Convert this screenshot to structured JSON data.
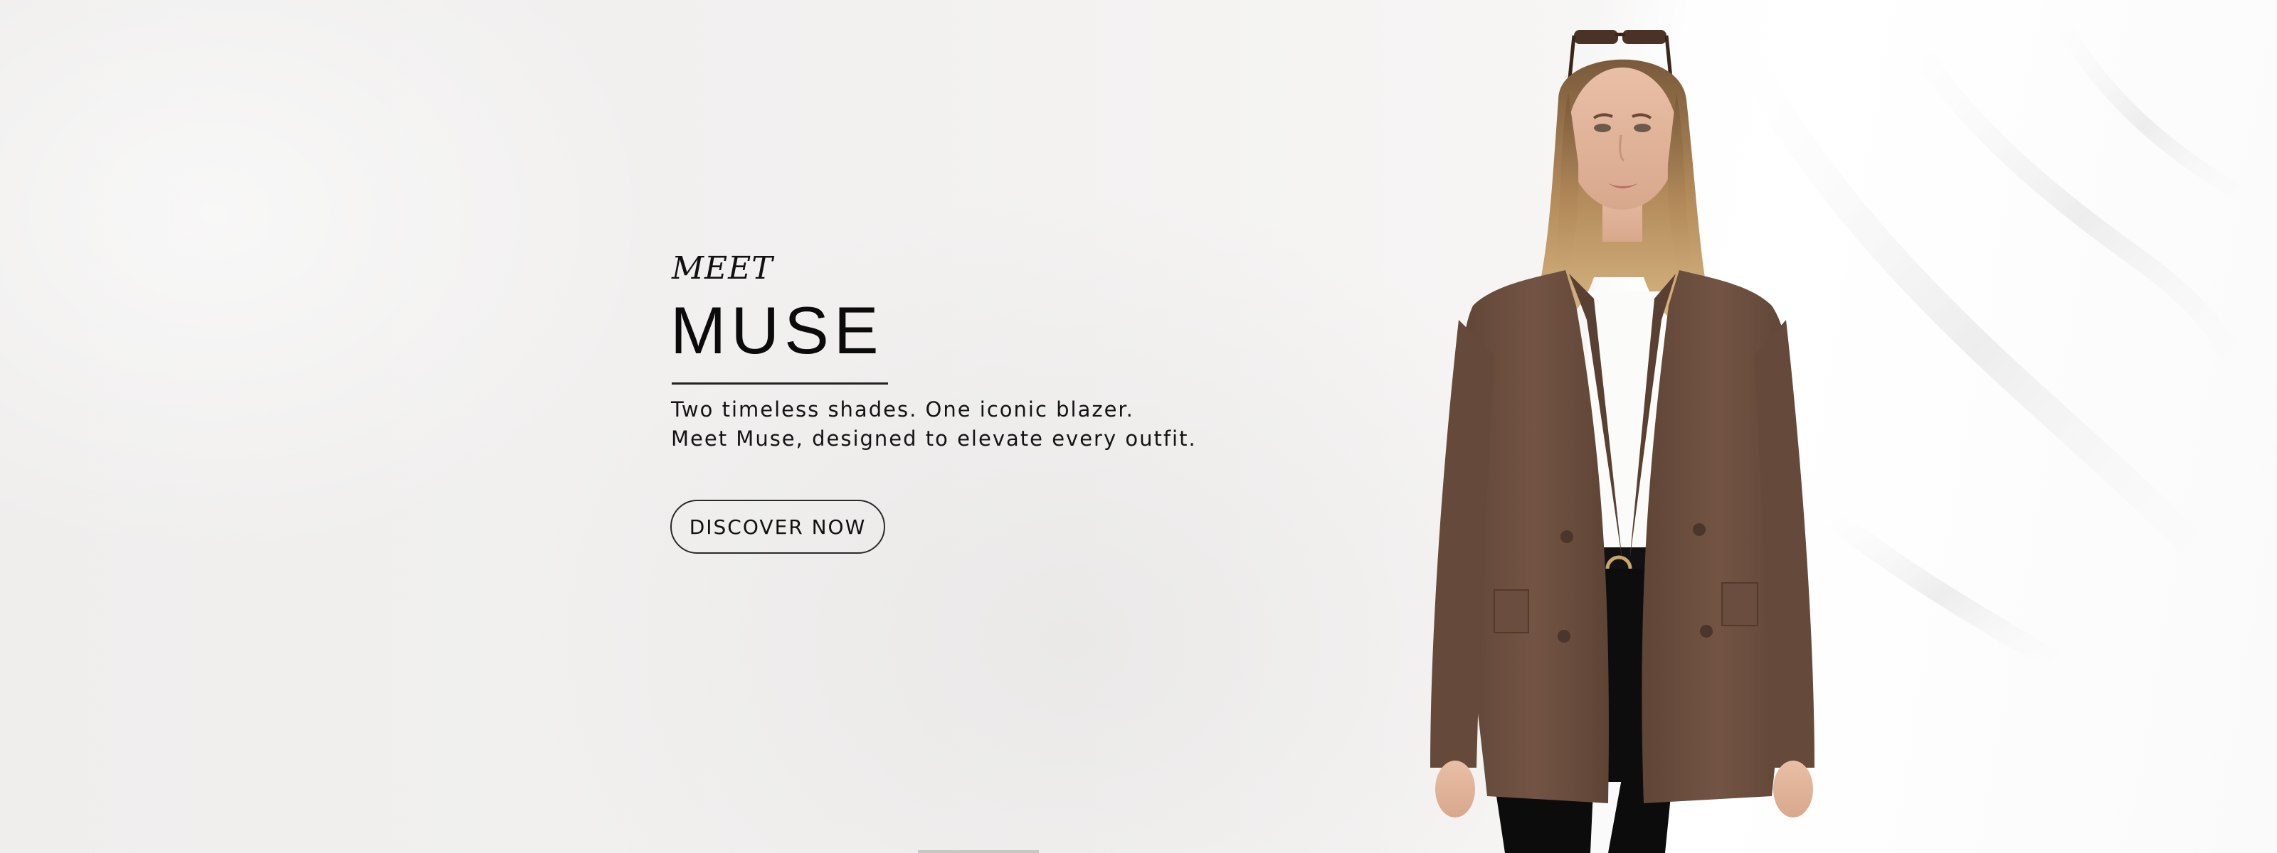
{
  "hero": {
    "eyebrow": "MEET",
    "title": "MUSE",
    "description_lines": [
      "Two timeless shades. One iconic blazer.",
      "Meet Muse, designed to elevate every outfit."
    ],
    "cta_label": "DISCOVER NOW"
  },
  "colors": {
    "background": "#f0efee",
    "blazer": "#6e5141",
    "text": "#111111"
  }
}
